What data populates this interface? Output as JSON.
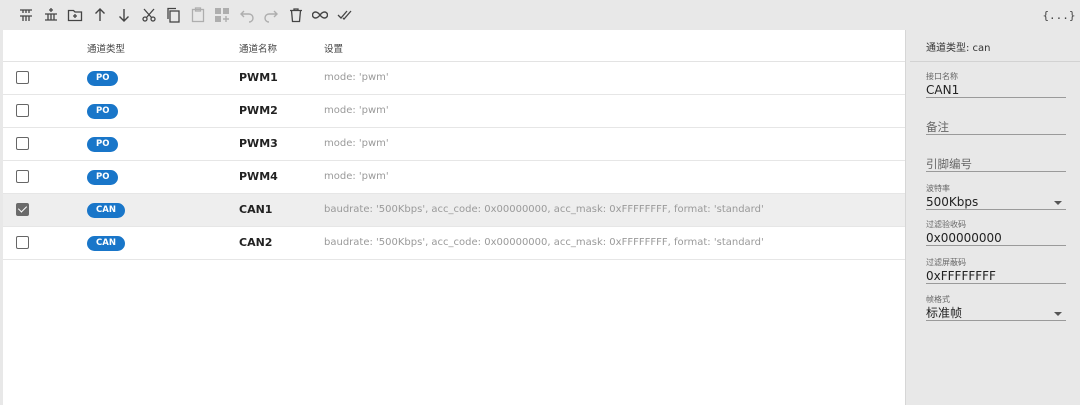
{
  "toolbar": {
    "icons": [
      "insert-above-icon",
      "insert-below-icon",
      "new-folder-icon",
      "move-up-icon",
      "move-down-icon",
      "cut-icon",
      "copy-icon",
      "paste-icon",
      "add-grid-icon",
      "undo-icon",
      "redo-icon",
      "delete-icon",
      "link-icon",
      "check-all-icon"
    ],
    "json_label": "{...}"
  },
  "table": {
    "headers": {
      "type": "通道类型",
      "name": "通道名称",
      "settings": "设置"
    },
    "rows": [
      {
        "checked": false,
        "type": "PO",
        "name": "PWM1",
        "settings": "mode: 'pwm'"
      },
      {
        "checked": false,
        "type": "PO",
        "name": "PWM2",
        "settings": "mode: 'pwm'"
      },
      {
        "checked": false,
        "type": "PO",
        "name": "PWM3",
        "settings": "mode: 'pwm'"
      },
      {
        "checked": false,
        "type": "PO",
        "name": "PWM4",
        "settings": "mode: 'pwm'"
      },
      {
        "checked": true,
        "type": "CAN",
        "name": "CAN1",
        "settings": "baudrate: '500Kbps', acc_code: 0x00000000, acc_mask: 0xFFFFFFFF, format: 'standard'"
      },
      {
        "checked": false,
        "type": "CAN",
        "name": "CAN2",
        "settings": "baudrate: '500Kbps', acc_code: 0x00000000, acc_mask: 0xFFFFFFFF, format: 'standard'"
      }
    ]
  },
  "side": {
    "title": "通道类型: can",
    "interface_name": {
      "label": "接口名称",
      "value": "CAN1"
    },
    "remark": {
      "placeholder": "备注"
    },
    "pin": {
      "placeholder": "引脚编号"
    },
    "baudrate": {
      "label": "波特率",
      "value": "500Kbps"
    },
    "acc_code": {
      "label": "过滤验收码",
      "value": "0x00000000"
    },
    "acc_mask": {
      "label": "过滤屏蔽码",
      "value": "0xFFFFFFFF"
    },
    "frame_format": {
      "label": "帧格式",
      "value": "标准帧"
    }
  },
  "colors": {
    "badge": "#1976c9",
    "selected_row": "#eeeeee",
    "background": "#e8e8e8"
  }
}
